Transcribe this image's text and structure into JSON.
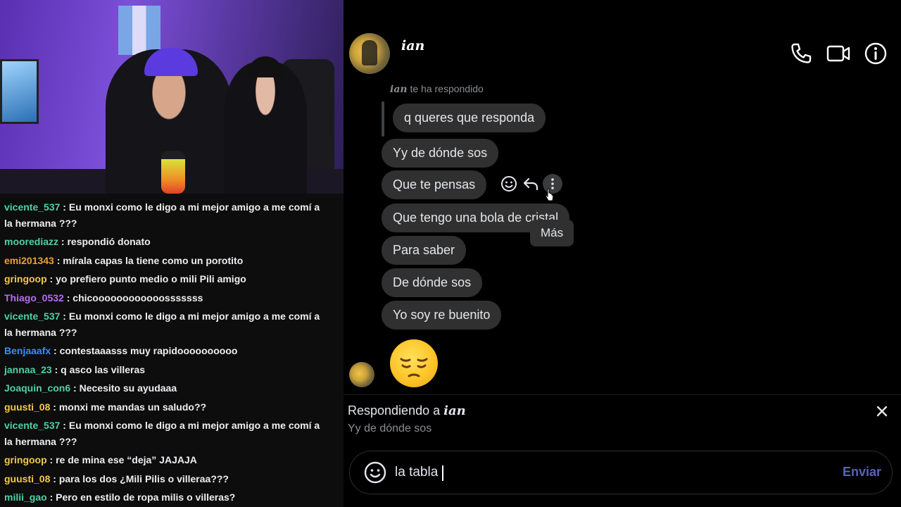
{
  "chat": [
    {
      "user": "vicente_537",
      "color": "#4fd1a5",
      "text": "Eu monxi como le digo a mi mejor amigo a me comí a la hermana ???"
    },
    {
      "user": "moorediazz",
      "color": "#4fd1a5",
      "text": "respondió donato"
    },
    {
      "user": "emi201343",
      "color": "#f0a030",
      "text": "mírala capas la tiene como un porotito"
    },
    {
      "user": "gringoop",
      "color": "#f2c94c",
      "text": "yo prefiero punto medio o mili Pili amigo"
    },
    {
      "user": "Thiago_0532",
      "color": "#b86cf0",
      "text": "chicoooooooooooosssssss"
    },
    {
      "user": "vicente_537",
      "color": "#4fd1a5",
      "text": "Eu monxi como le digo a mi mejor amigo a me comí a la hermana ???"
    },
    {
      "user": "Benjaaafx",
      "color": "#3d8bfd",
      "text": "contestaaasss muy rapidoooooooooo"
    },
    {
      "user": "jannaa_23",
      "color": "#4fd1a5",
      "text": "q asco las villeras"
    },
    {
      "user": "Joaquin_con6",
      "color": "#4fd1a5",
      "text": "Necesito su ayudaaa"
    },
    {
      "user": "guusti_08",
      "color": "#f2c94c",
      "text": "monxi me mandas un saludo??"
    },
    {
      "user": "vicente_537",
      "color": "#4fd1a5",
      "text": "Eu monxi como le digo a mi mejor amigo a me comí a la hermana ???"
    },
    {
      "user": "gringoop",
      "color": "#f2c94c",
      "text": "re de mina ese “deja” JAJAJA"
    },
    {
      "user": "guusti_08",
      "color": "#f2c94c",
      "text": "para los dos ¿Mili Pilis o villeraa???"
    },
    {
      "user": "milii_gao",
      "color": "#4fd1a5",
      "text": "Pero en estilo de ropa milis o villeras?"
    }
  ],
  "chat_separator": " : ",
  "messenger": {
    "contact_name": "ian",
    "reply_note_name": "ian",
    "reply_note_text": " te ha respondido",
    "messages": [
      {
        "text": "q queres que responda",
        "quoted": true
      },
      {
        "text": "Yy de dónde sos",
        "quoted": false
      },
      {
        "text": "Que te pensas",
        "quoted": false
      },
      {
        "text": "Que tengo una bola de cristal",
        "quoted": false
      },
      {
        "text": "Para saber",
        "quoted": false
      },
      {
        "text": "De dónde sos",
        "quoted": false
      },
      {
        "text": "Yo soy re buenito",
        "quoted": false
      }
    ],
    "tooltip": "Más",
    "emoji_message": "pensive-face",
    "reply_banner": {
      "prefix": "Respondiendo a ",
      "name": "ian",
      "preview": "Yy de dónde sos"
    },
    "composer": {
      "value": "la tabla",
      "send_label": "Enviar"
    },
    "icons": [
      "phone-icon",
      "video-icon",
      "info-icon",
      "smiley-icon",
      "reply-icon",
      "more-icon",
      "close-icon"
    ]
  },
  "colors": {
    "bubble": "#303030",
    "send": "#5865b8",
    "chat_bg": "#0d0d0e"
  }
}
